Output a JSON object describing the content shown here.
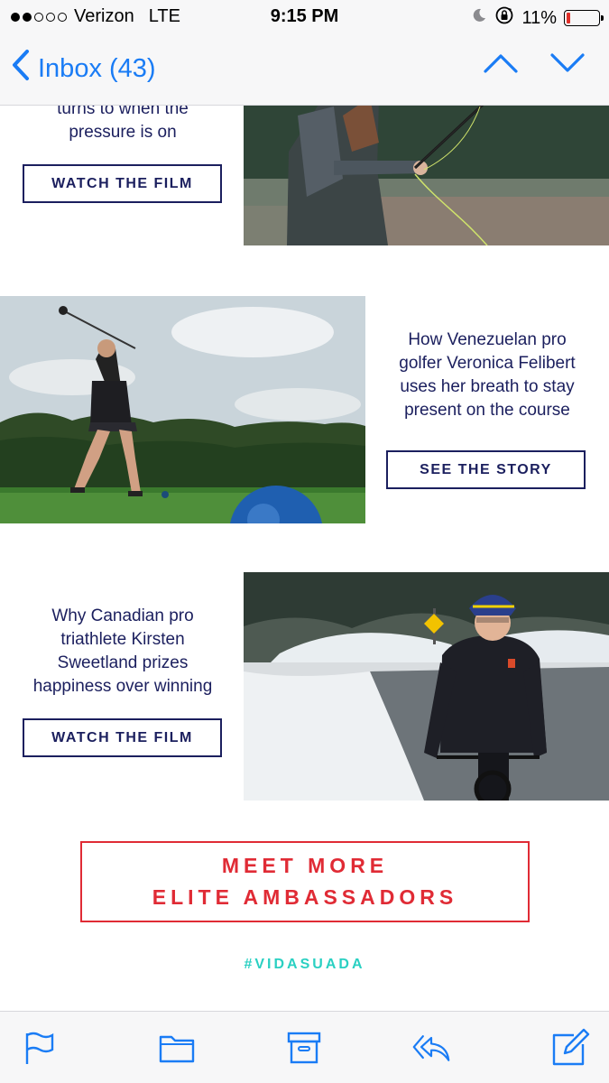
{
  "status_bar": {
    "carrier": "Verizon",
    "network": "LTE",
    "time": "9:15 PM",
    "battery": "11%",
    "battery_level": 0.11,
    "signal_bars": 2,
    "icons": [
      "moon-icon",
      "rotation-lock-icon",
      "battery-icon"
    ]
  },
  "nav": {
    "back_label": "Inbox (43)",
    "icons": [
      "chevron-left-icon",
      "chevron-up-icon",
      "chevron-down-icon"
    ]
  },
  "email": {
    "section1": {
      "blurb_tail": [
        "turns to when the",
        "pressure is on"
      ],
      "button": "WATCH THE FILM"
    },
    "section2": {
      "blurb": [
        "How Venezuelan pro",
        "golfer Veronica Felibert",
        "uses her breath to stay",
        "present on the course"
      ],
      "button": "SEE THE STORY"
    },
    "section3": {
      "blurb": [
        "Why Canadian pro",
        "triathlete Kirsten",
        "Sweetland prizes",
        "happiness over winning"
      ],
      "button": "WATCH THE FILM"
    },
    "cta": [
      "MEET MORE",
      "ELITE AMBASSADORS"
    ],
    "hashtag": "#VIDASUADA"
  },
  "toolbar": {
    "icons": [
      "flag-icon",
      "folder-icon",
      "archive-icon",
      "reply-icon",
      "compose-icon"
    ]
  },
  "colors": {
    "ios_blue": "#1a7cf5",
    "navy": "#1b1f5e",
    "cta_red": "#e02b35",
    "hashtag_teal": "#2ad0c2",
    "battery_red": "#e0302a"
  }
}
